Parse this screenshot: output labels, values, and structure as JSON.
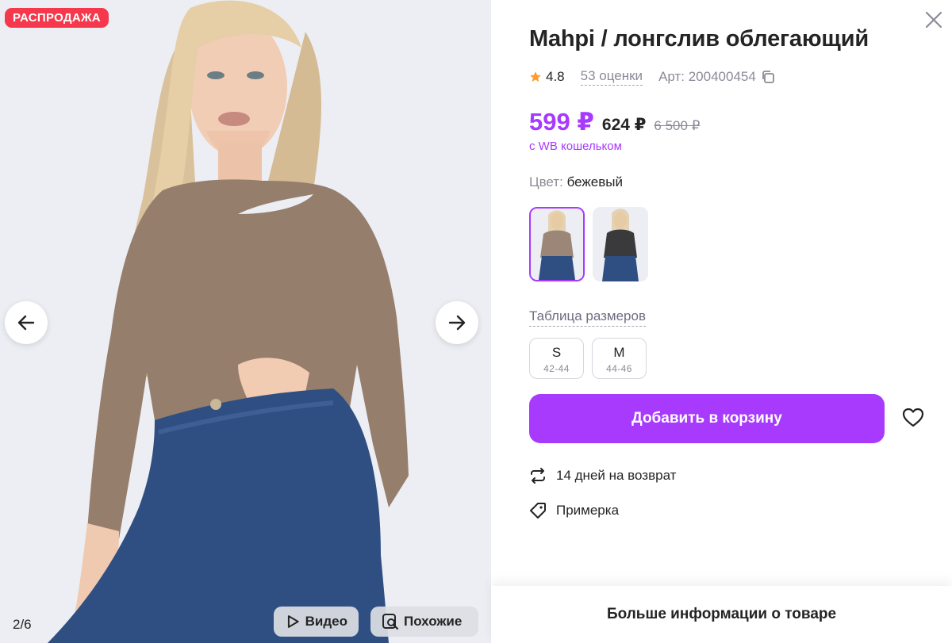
{
  "gallery": {
    "badge": "РАСПРОДАЖА",
    "counter": "2/6",
    "video_label": "Видео",
    "similar_label": "Похожие"
  },
  "product": {
    "title": "Mahpi / лонгслив облегающий",
    "rating": "4.8",
    "reviews": "53 оценки",
    "article": "Арт: 200400454",
    "price": "599 ₽",
    "price_regular": "624 ₽",
    "price_old": "6 500 ₽",
    "wallet_note": "с WB кошельком",
    "color_label": "Цвет:",
    "color_value": "бежевый",
    "size_table": "Таблица размеров",
    "sizes": [
      {
        "name": "S",
        "ru": "42-44"
      },
      {
        "name": "M",
        "ru": "44-46"
      }
    ],
    "cart_button": "Добавить в корзину",
    "return_note": "14 дней на возврат",
    "fitting_note": "Примерка",
    "more_info": "Больше информации о товаре"
  },
  "colors": {
    "accent": "#a73afd",
    "sale": "#f5384c",
    "star": "#ff9d2e",
    "swatch_beige": "#9b8677",
    "swatch_black": "#3a3a3c"
  }
}
